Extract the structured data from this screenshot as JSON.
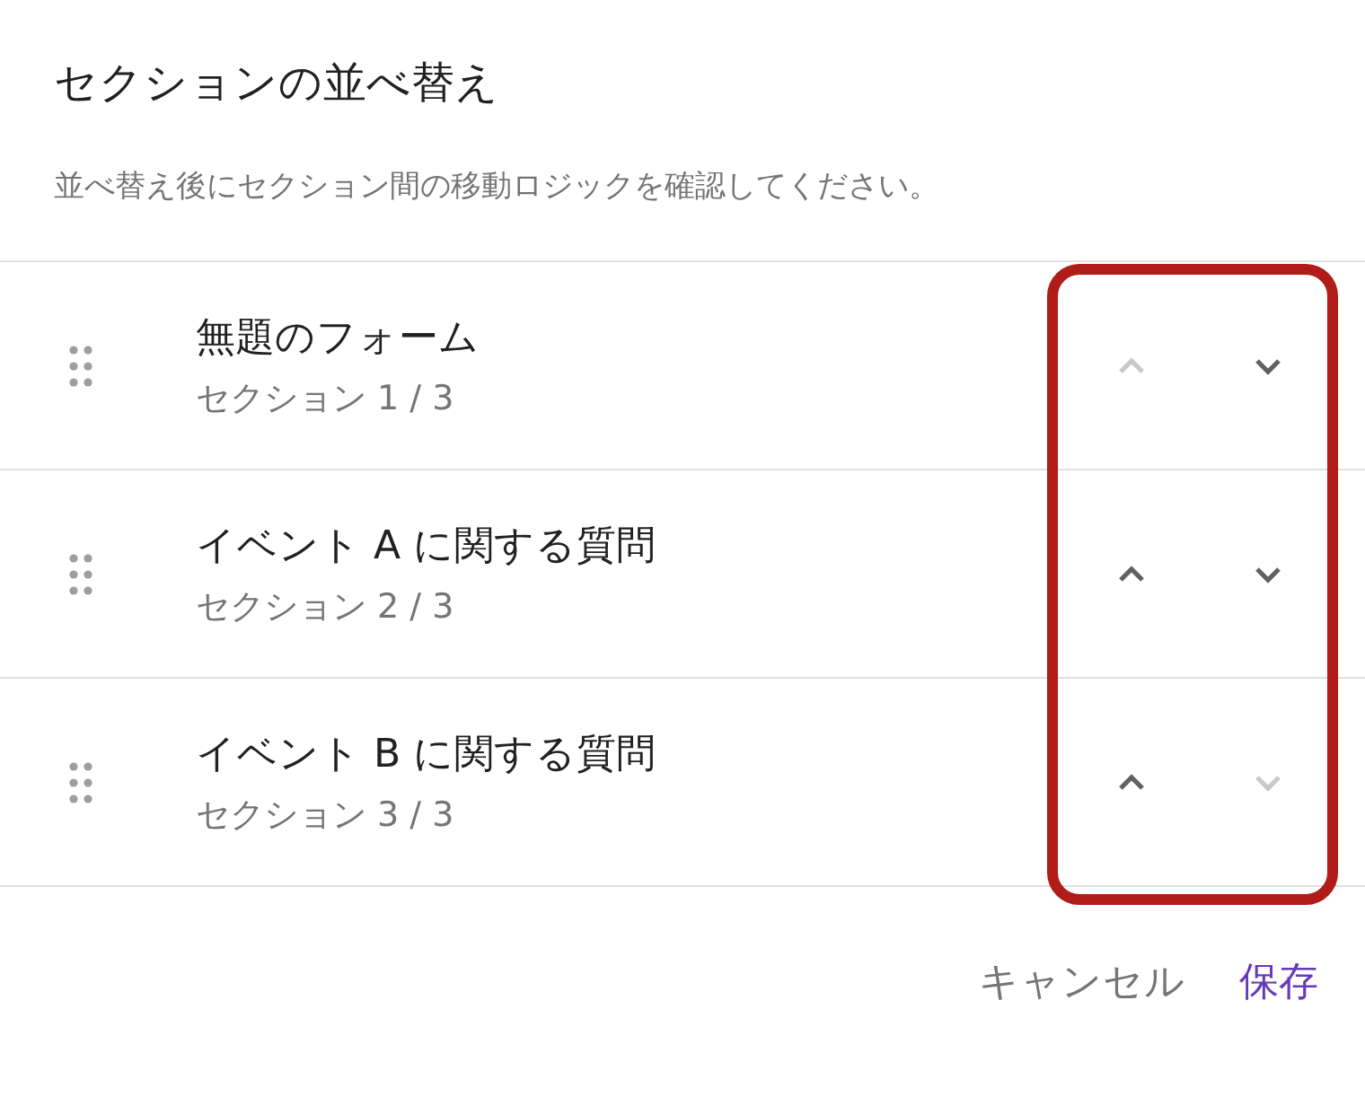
{
  "dialog": {
    "title": "セクションの並べ替え",
    "description": "並べ替え後にセクション間の移動ロジックを確認してください。"
  },
  "sections": [
    {
      "title": "無題のフォーム",
      "subtitle": "セクション 1 / 3",
      "up_disabled": true,
      "down_disabled": false
    },
    {
      "title": "イベント A に関する質問",
      "subtitle": "セクション 2 / 3",
      "up_disabled": false,
      "down_disabled": false
    },
    {
      "title": "イベント B に関する質問",
      "subtitle": "セクション 3 / 3",
      "up_disabled": false,
      "down_disabled": true
    }
  ],
  "buttons": [
    {
      "kind": "cancel",
      "label": "キャンセル"
    },
    {
      "kind": "save",
      "label": "保存"
    }
  ]
}
